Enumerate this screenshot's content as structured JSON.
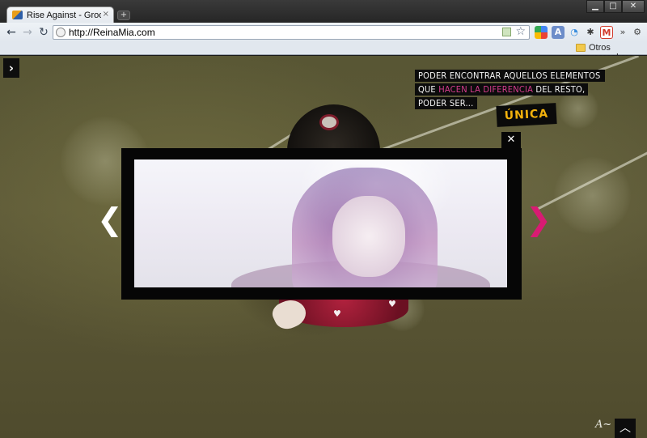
{
  "browser": {
    "tab": {
      "title": "Rise Against - Grooveshark",
      "close": "×"
    },
    "new_tab": "+",
    "window_controls": {
      "minimize": "▁",
      "maximize": "□",
      "close": "✕"
    },
    "nav": {
      "back": "←",
      "forward": "→",
      "reload": "↻"
    },
    "omnibox": {
      "url": "http://ReinaMia.com"
    },
    "extensions": {
      "more": "»",
      "wrench": "🔧"
    },
    "bookmarks_bar": {
      "other_bookmarks": "Otros marcadores"
    }
  },
  "page": {
    "menu_toggle": "›",
    "tagline": {
      "line1": "PODER ENCONTRAR AQUELLOS ELEMENTOS",
      "line2_prefix": "QUE ",
      "line2_highlight": "HACEN LA DIFERENCIA",
      "line2_suffix": " DEL RESTO,",
      "line3": "PODER SER...",
      "emphasis": "ÚNICA"
    },
    "lightbox": {
      "close": "✕"
    },
    "gallery": {
      "prev": "❮",
      "next": "❯"
    },
    "scroll_top": "︿",
    "colors": {
      "accent_pink": "#d63c8e",
      "accent_yellow": "#f2b10c",
      "arrow_next": "#d81b73"
    }
  }
}
